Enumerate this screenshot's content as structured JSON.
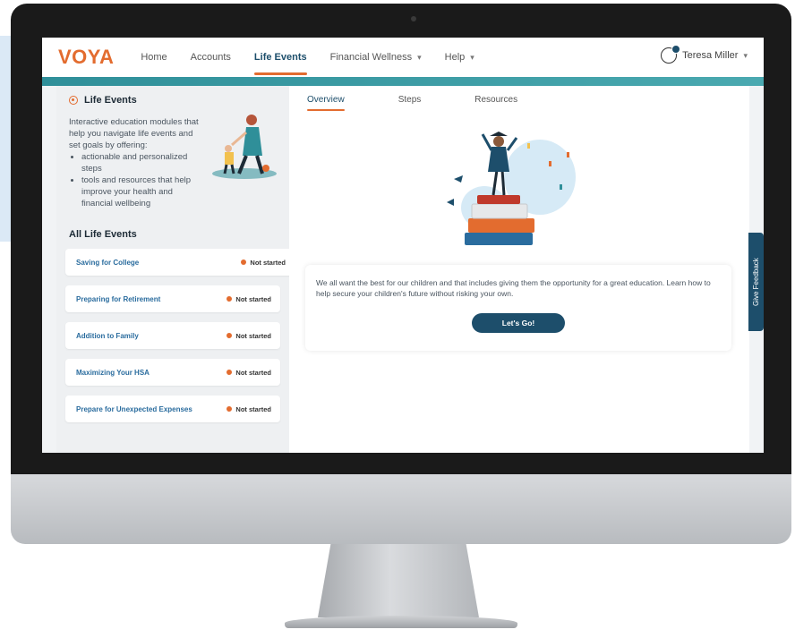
{
  "brand": {
    "logo": "VOYA",
    "accent": "#e36c2f",
    "primary": "#1d4e6b",
    "teal": "#2f8f99"
  },
  "nav": {
    "items": [
      {
        "label": "Home",
        "active": false,
        "dropdown": false
      },
      {
        "label": "Accounts",
        "active": false,
        "dropdown": false
      },
      {
        "label": "Life Events",
        "active": true,
        "dropdown": false
      },
      {
        "label": "Financial Wellness",
        "active": false,
        "dropdown": true
      },
      {
        "label": "Help",
        "active": false,
        "dropdown": true
      }
    ],
    "user_name": "Teresa Miller"
  },
  "sidebar": {
    "title": "Life Events",
    "intro": "Interactive education modules that help you navigate life events and set goals by offering:",
    "bullets": [
      "actionable and personalized steps",
      "tools and resources that help improve your health and financial wellbeing"
    ],
    "list_title": "All Life Events",
    "events": [
      {
        "name": "Saving for College",
        "status": "Not started"
      },
      {
        "name": "Preparing for Retirement",
        "status": "Not started"
      },
      {
        "name": "Addition to Family",
        "status": "Not started"
      },
      {
        "name": "Maximizing Your HSA",
        "status": "Not started"
      },
      {
        "name": "Prepare for Unexpected Expenses",
        "status": "Not started"
      }
    ]
  },
  "main": {
    "tabs": [
      {
        "label": "Overview",
        "active": true
      },
      {
        "label": "Steps",
        "active": false
      },
      {
        "label": "Resources",
        "active": false
      }
    ],
    "card_text": "We all want the best for our children and that includes giving them the opportunity for a great education. Learn how to help secure your children's future without risking your own.",
    "cta_label": "Let's Go!"
  },
  "feedback_label": "Give Feedback",
  "icons": [
    "user-avatar-icon",
    "caret-down-icon",
    "life-events-icon",
    "status-dot-icon"
  ]
}
